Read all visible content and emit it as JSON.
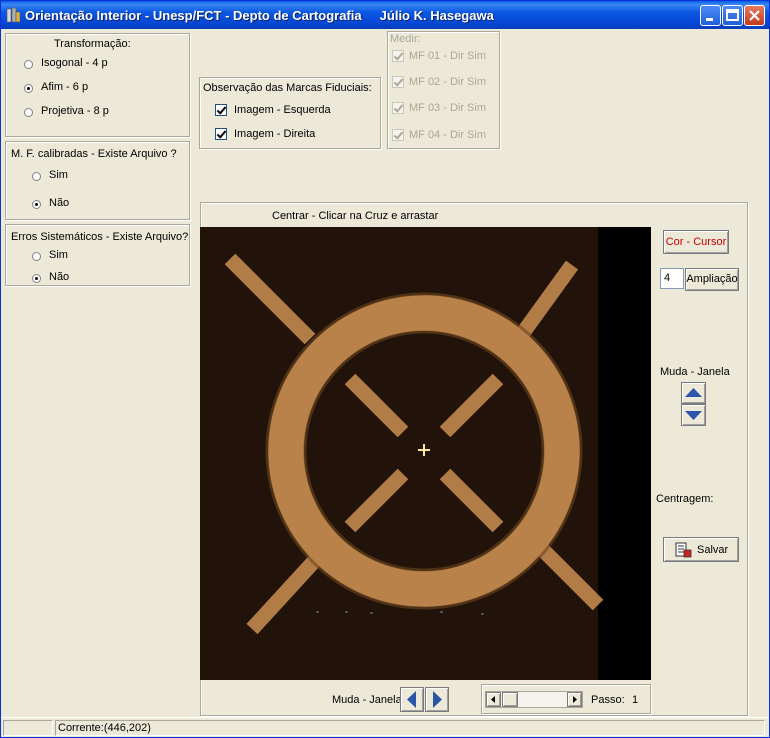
{
  "window": {
    "title": "Orientação Interior - Unesp/FCT - Depto de Cartografia     Júlio K. Hasegawa"
  },
  "transformacao": {
    "title": "Transformação:",
    "options": [
      "Isogonal - 4 p",
      "Afim - 6 p",
      "Projetiva - 8 p"
    ],
    "selected": "Afim - 6 p"
  },
  "observacao": {
    "title": "Observação das Marcas Fiduciais:",
    "options": [
      {
        "label": "Imagem - Esquerda",
        "checked": true
      },
      {
        "label": "Imagem - Direita",
        "checked": true
      }
    ]
  },
  "medir": {
    "title": "Medir:",
    "items": [
      {
        "label": "MF 01 - Dir Sim",
        "checked": true
      },
      {
        "label": "MF 02 - Dir Sim",
        "checked": true
      },
      {
        "label": "MF 03 - Dir Sim",
        "checked": true
      },
      {
        "label": "MF 04 - Dir Sim",
        "checked": true
      }
    ]
  },
  "mf_calibradas": {
    "title": "M. F. calibradas - Existe Arquivo ?",
    "options": [
      "Sim",
      "Não"
    ],
    "selected": "Não"
  },
  "erros": {
    "title": "Erros Sistemáticos - Existe Arquivo?",
    "options": [
      "Sim",
      "Não"
    ],
    "selected": "Não"
  },
  "viewer": {
    "caption": "Centrar - Clicar na Cruz e arrastar"
  },
  "controls": {
    "cor_cursor": "Cor - Cursor",
    "ampliacao_value": "4",
    "ampliacao_label": "Ampliação",
    "muda_janela_label": "Muda - Janela",
    "centragem_label": "Centragem:",
    "salvar": "Salvar"
  },
  "bottom": {
    "muda_janela_label": "Muda - Janela",
    "passo_label": "Passo:",
    "passo_value": "1"
  },
  "status": {
    "corrente": "Corrente:(446,202)"
  },
  "colors": {
    "title_blue": "#0b58e2",
    "window_bg": "#ece9d8",
    "ring": "#b9824a",
    "button_red_text": "#cc0000",
    "arrow_blue": "#2b55a8"
  }
}
